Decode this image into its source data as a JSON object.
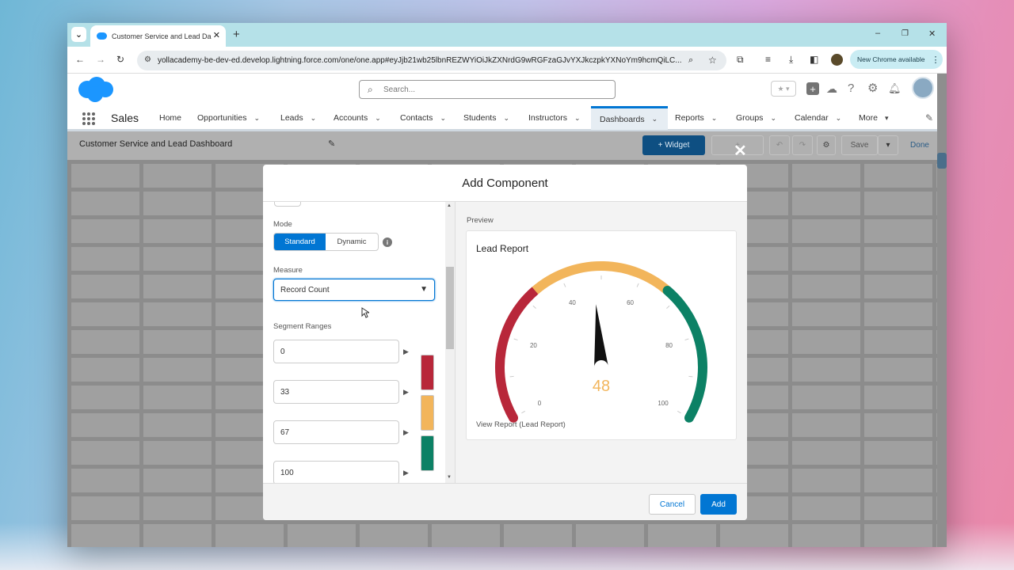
{
  "browser": {
    "tab_title": "Customer Service and Lead Dashboard",
    "tab_close": "✕",
    "new_tab": "+",
    "tab_menu": "⌄",
    "win_minimize": "–",
    "win_restore": "❐",
    "win_close": "✕",
    "url": "yollacademy-be-dev-ed.develop.lightning.force.com/one/one.app#eyJjb21wb25lbnREZWYiOiJkZXNrdG9wRGFzaGJvYXJkczpkYXNoYm9hcmQiLC...",
    "new_chrome": "New Chrome available"
  },
  "salesforce": {
    "search_placeholder": "Search...",
    "app_name": "Sales",
    "nav": [
      {
        "label": "Home",
        "chev": ""
      },
      {
        "label": "Opportunities",
        "chev": "⌄"
      },
      {
        "label": "Leads",
        "chev": "⌄"
      },
      {
        "label": "Accounts",
        "chev": "⌄"
      },
      {
        "label": "Contacts",
        "chev": "⌄"
      },
      {
        "label": "Students",
        "chev": "⌄"
      },
      {
        "label": "Instructors",
        "chev": "⌄"
      },
      {
        "label": "Dashboards",
        "chev": "⌄"
      },
      {
        "label": "Reports",
        "chev": "⌄"
      },
      {
        "label": "Groups",
        "chev": "⌄"
      },
      {
        "label": "Calendar",
        "chev": "⌄"
      },
      {
        "label": "More",
        "chev": "▾"
      }
    ],
    "dashboard_title": "Customer Service and Lead Dashboard",
    "widget_button": "+ Widget",
    "add_button": "+",
    "save_button": "Save",
    "done_button": "Done"
  },
  "modal": {
    "title": "Add Component",
    "close": "✕",
    "mode_label": "Mode",
    "mode_options": [
      "Standard",
      "Dynamic"
    ],
    "mode_selected": "Standard",
    "measure_label": "Measure",
    "measure_value": "Record Count",
    "segment_label": "Segment Ranges",
    "segments": [
      "0",
      "33",
      "67",
      "100"
    ],
    "segment_colors": [
      "#b8273a",
      "#f2b55b",
      "#0c8165"
    ],
    "preview_label": "Preview",
    "cancel": "Cancel",
    "add": "Add"
  },
  "gauge": {
    "title": "Lead Report",
    "value": 48,
    "value_label": "48",
    "min": 0,
    "max": 100,
    "ticks": [
      "0",
      "20",
      "40",
      "60",
      "80",
      "100"
    ],
    "bands": [
      {
        "from": 0,
        "to": 33,
        "color": "#b8273a"
      },
      {
        "from": 33,
        "to": 67,
        "color": "#f2b55b"
      },
      {
        "from": 67,
        "to": 100,
        "color": "#0c8165"
      }
    ],
    "link": "View Report (Lead Report)"
  }
}
